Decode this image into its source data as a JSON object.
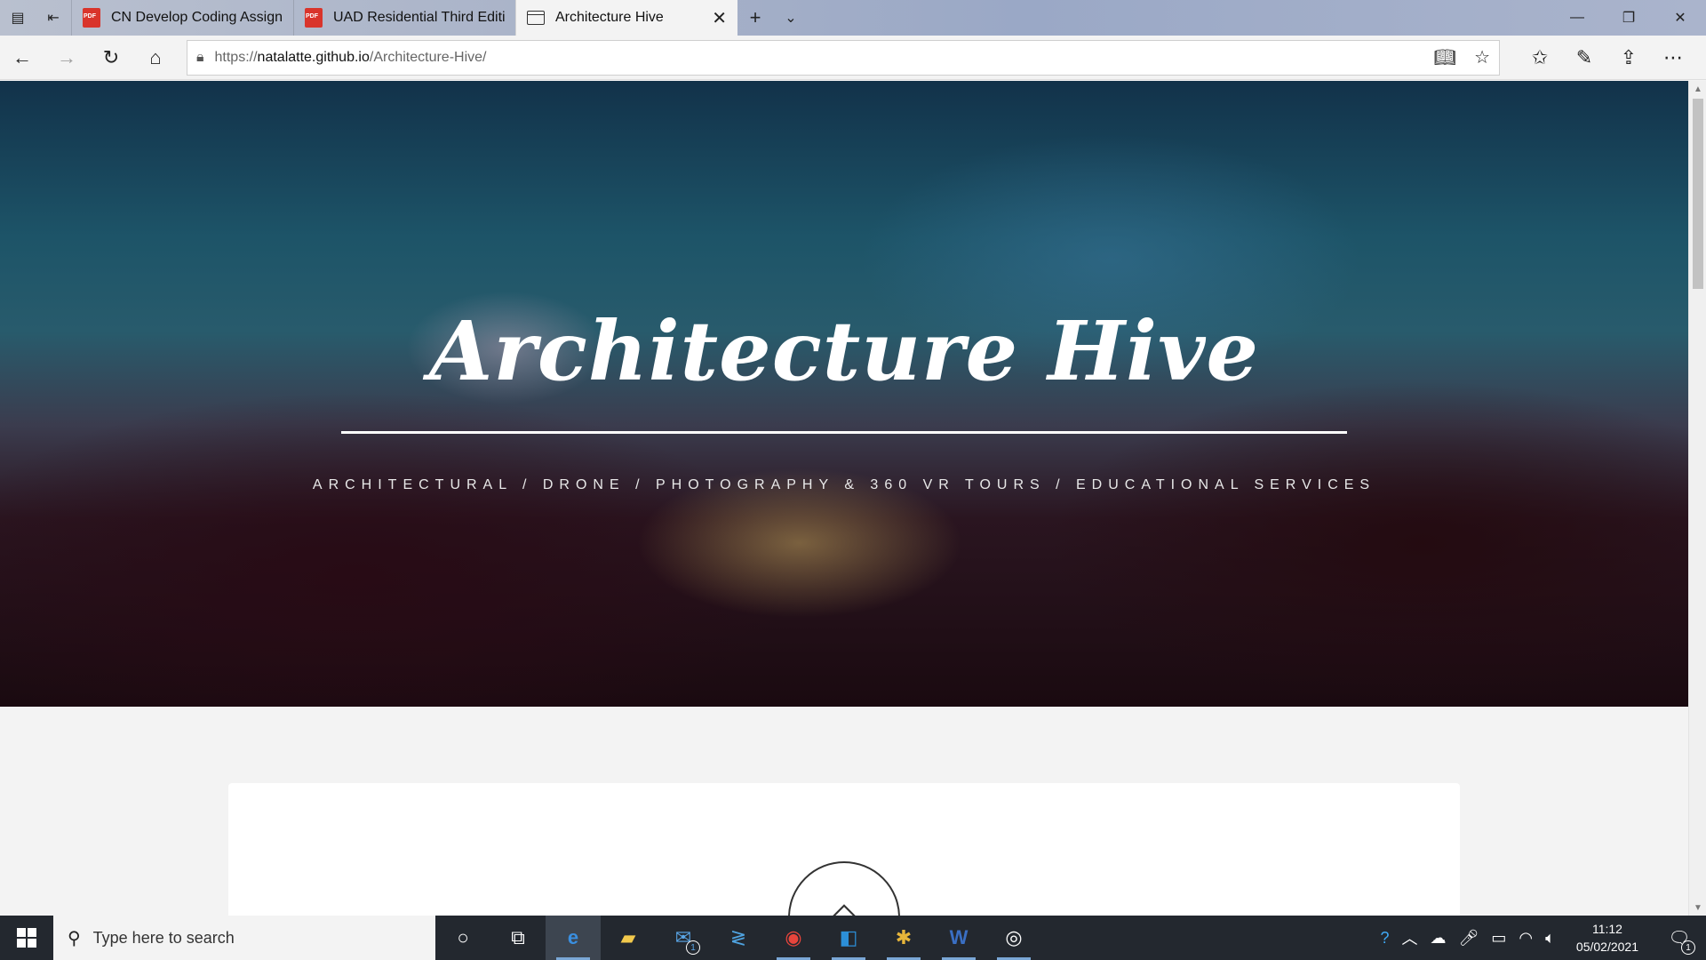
{
  "browser": {
    "tabs": [
      {
        "label": "CN Develop Coding Assignr",
        "icon": "pdf-icon"
      },
      {
        "label": "UAD Residential Third Editic",
        "icon": "pdf-icon"
      },
      {
        "label": "Architecture Hive",
        "icon": "page-icon"
      }
    ],
    "address": {
      "url_prefix": "https://",
      "url_host": "natalatte.github.io",
      "url_path": "/Architecture-Hive/"
    }
  },
  "page": {
    "hero_title": "Architecture Hive",
    "hero_subtitle": "ARCHITECTURAL / DRONE / PHOTOGRAPHY & 360 VR TOURS / EDUCATIONAL SERVICES",
    "card_icon": "diamond-icon"
  },
  "taskbar": {
    "search_placeholder": "Type here to search",
    "mail_badge": "1",
    "notification_badge": "1",
    "time": "11:12",
    "date": "05/02/2021"
  },
  "colors": {
    "hero_text": "#ffffff",
    "taskbar": "#23282f",
    "page_bg": "#f3f3f3"
  }
}
